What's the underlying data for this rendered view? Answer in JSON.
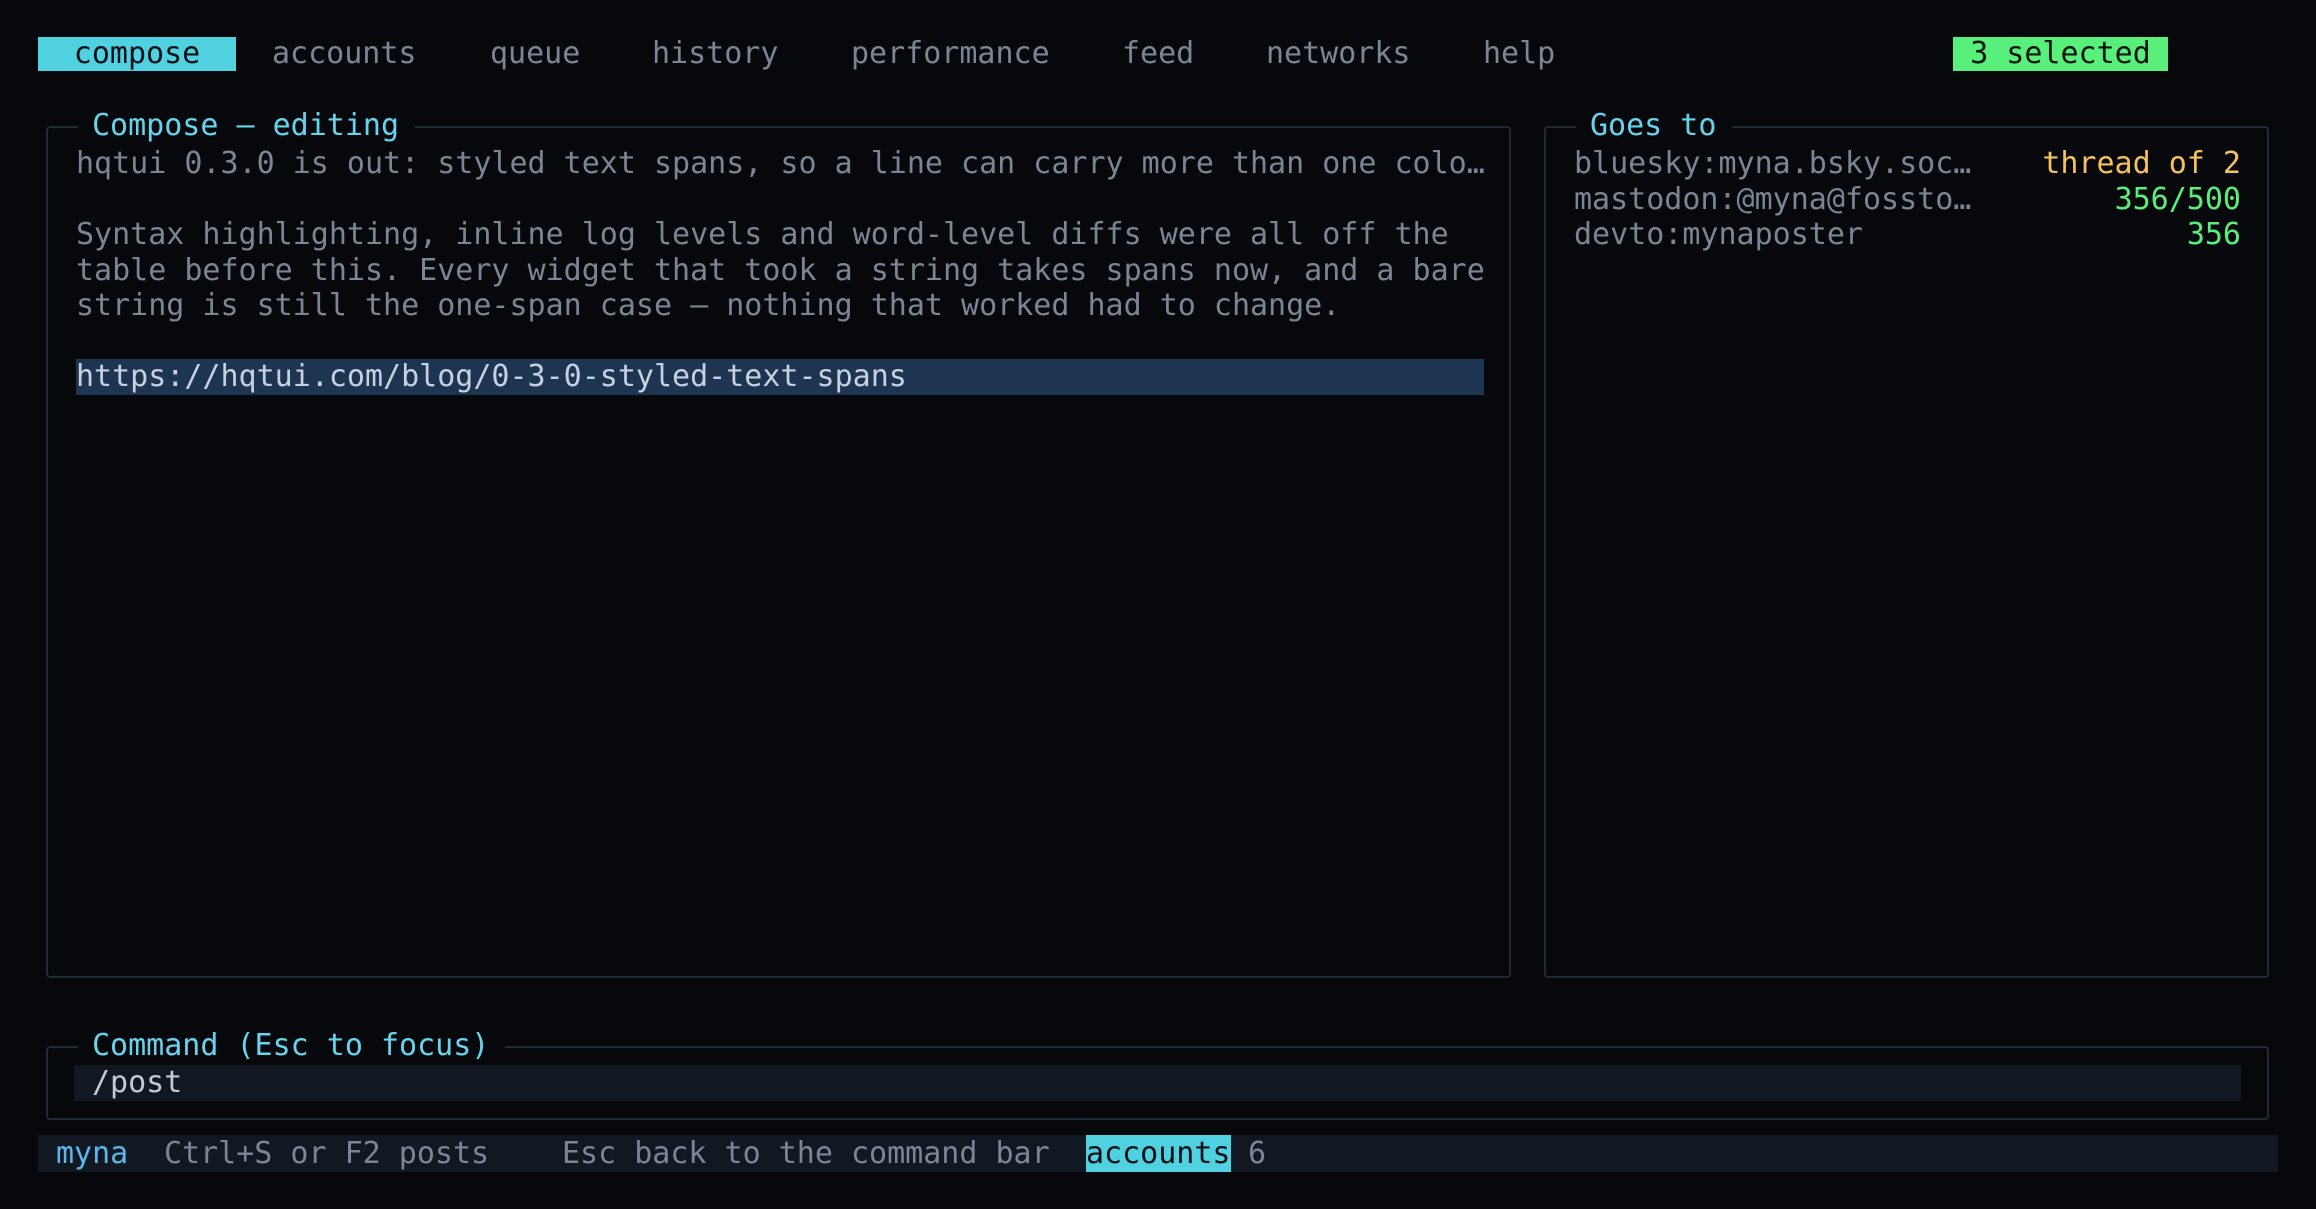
{
  "tabs": [
    {
      "label": "compose",
      "active": true
    },
    {
      "label": "accounts"
    },
    {
      "label": "queue"
    },
    {
      "label": "history"
    },
    {
      "label": "performance"
    },
    {
      "label": "feed"
    },
    {
      "label": "networks"
    },
    {
      "label": "help"
    }
  ],
  "selection": {
    "badge": "3 selected"
  },
  "compose": {
    "title": "Compose — editing",
    "lines": [
      "hqtui 0.3.0 is out: styled text spans, so a line can carry more than one colo…",
      "",
      "Syntax highlighting, inline log levels and word-level diffs were all off the",
      "table before this. Every widget that took a string takes spans now, and a bare",
      "string is still the one-span case — nothing that worked had to change.",
      "",
      "https://hqtui.com/blog/0-3-0-styled-text-spans"
    ]
  },
  "destinations": {
    "title": "Goes to",
    "items": [
      {
        "name": "bluesky:myna.bsky.soc…",
        "status": "thread of 2",
        "status_color": "#f5c15a"
      },
      {
        "name": "mastodon:@myna@fossto…",
        "status": "356/500",
        "status_color": "#58f07a"
      },
      {
        "name": "devto:mynaposter",
        "status": "356",
        "status_color": "#58f07a"
      }
    ]
  },
  "command": {
    "title": "Command (Esc to focus)",
    "value": "/post"
  },
  "statusbar": {
    "user": "myna",
    "hint1": "Ctrl+S or F2 posts",
    "hint2": "Esc back to the command bar",
    "highlight": "accounts",
    "count": "6"
  },
  "colors": {
    "accent": "#4fd1df",
    "title": "#67d4ee",
    "ok": "#58f07a",
    "warn": "#f5c15a",
    "url_bg": "#1d3550"
  }
}
